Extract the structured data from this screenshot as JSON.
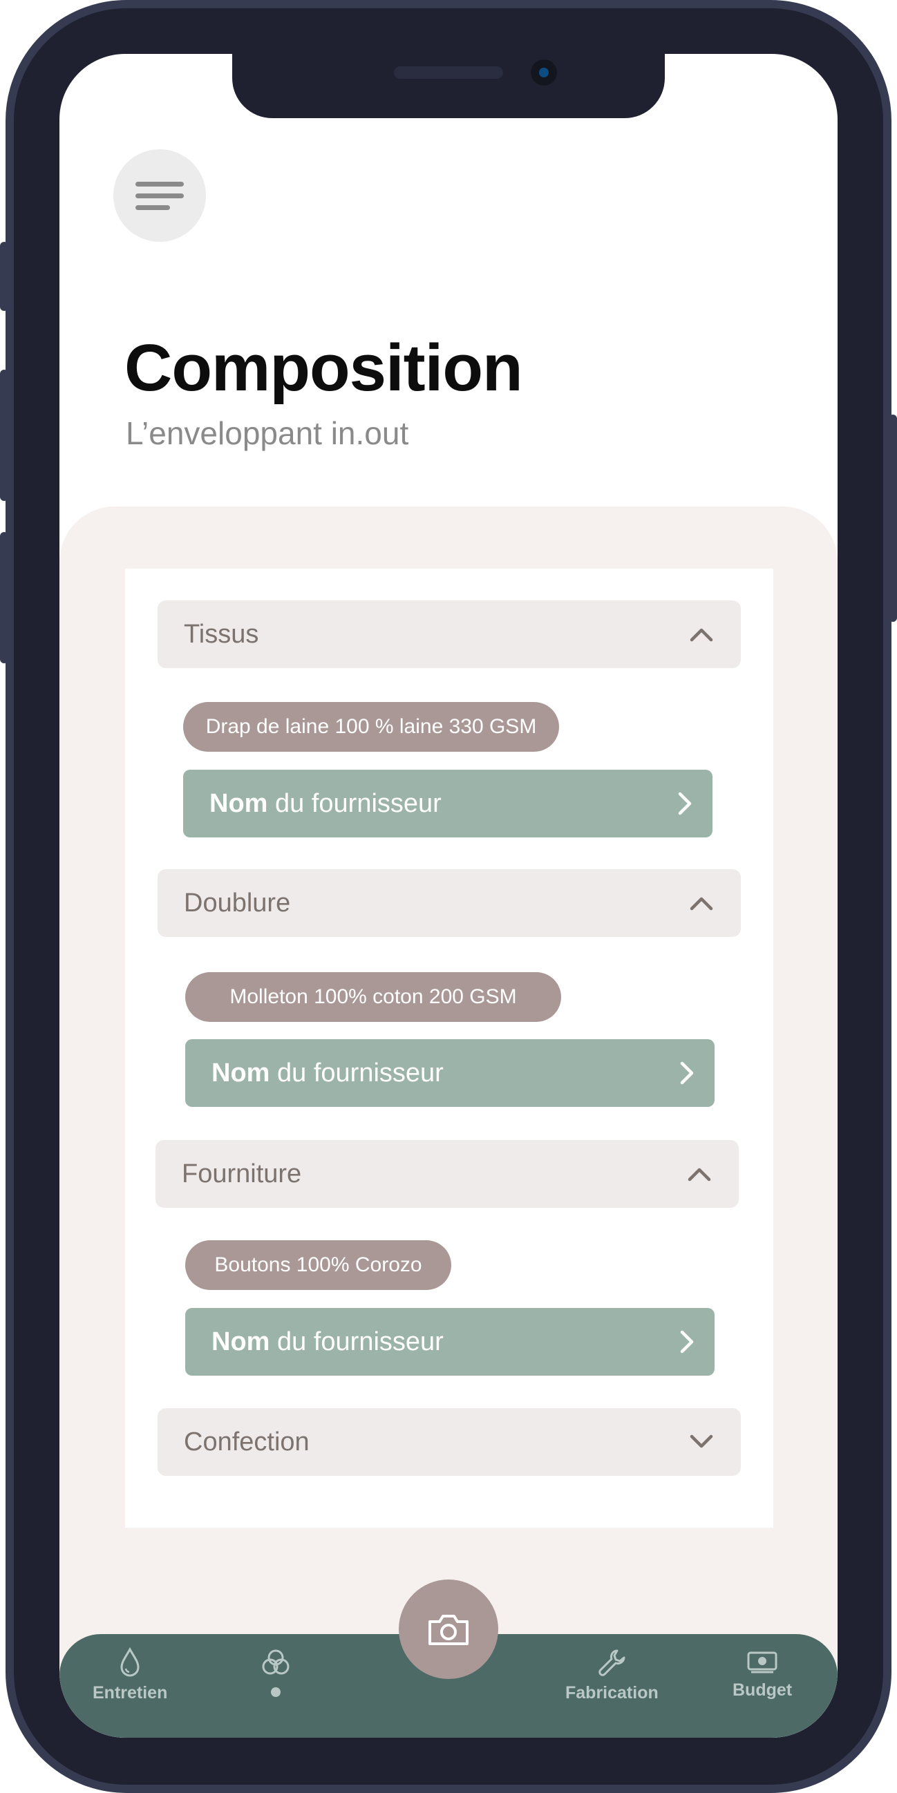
{
  "header": {
    "title": "Composition",
    "subtitle": "L’enveloppant in.out"
  },
  "sections": [
    {
      "label": "Tissus",
      "expanded": true,
      "material": "Drap de laine  100 % laine 330 GSM",
      "supplier_bold": "Nom",
      "supplier_rest": " du fournisseur"
    },
    {
      "label": "Doublure",
      "expanded": true,
      "material": "Molleton 100% coton  200 GSM",
      "supplier_bold": "Nom",
      "supplier_rest": " du fournisseur"
    },
    {
      "label": "Fourniture",
      "expanded": true,
      "material": "Boutons 100% Corozo",
      "supplier_bold": "Nom",
      "supplier_rest": " du fournisseur"
    },
    {
      "label": "Confection",
      "expanded": false
    }
  ],
  "bottom_nav": {
    "items": [
      {
        "label": "Entretien",
        "icon": "drop-icon"
      },
      {
        "label": "",
        "icon": "circles-icon",
        "active": true
      },
      {
        "label": "Fabrication",
        "icon": "wrench-icon"
      },
      {
        "label": "Budget",
        "icon": "money-icon"
      }
    ],
    "fab_icon": "camera-icon"
  },
  "colors": {
    "panel_bg": "#f6f1ef",
    "section_head_bg": "#efebea",
    "pill_bg": "#a99896",
    "supplier_bg": "#9cb3aa",
    "nav_bg": "#4d6a67"
  }
}
